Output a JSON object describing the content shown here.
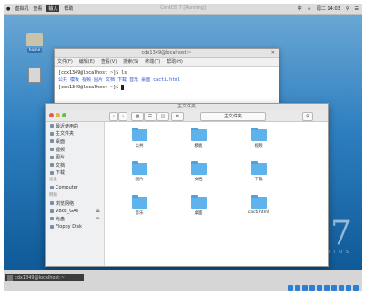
{
  "host": {
    "menubar": [
      "虚拟机",
      "查看",
      "输入",
      "帮助"
    ],
    "title": "CentOS 7 [Running]",
    "status_right": [
      "中",
      "周二 14:03"
    ]
  },
  "desktop": {
    "home_icon_label": "home",
    "brand_number": "7",
    "brand_text": "C E N T O S"
  },
  "terminal": {
    "title": "cdx1349@localhost:~",
    "menu": [
      "文件(F)",
      "编辑(E)",
      "查看(V)",
      "搜索(S)",
      "终端(T)",
      "帮助(H)"
    ],
    "lines": [
      "[cdx1349@localhost ~]$ ls",
      "[cdx1349@localhost ~]$ "
    ],
    "ls_output": "公共  模板  视频  图片  文档  下载  音乐  桌面  cacti.html"
  },
  "file_manager": {
    "title": "主文件夹",
    "sidebar": {
      "places": [
        "最近使用的",
        "主文件夹",
        "桌面",
        "视频",
        "图片",
        "文档",
        "下载",
        "音乐"
      ],
      "devices_header": "设备",
      "devices": [
        "Computer"
      ],
      "network_header": "网络",
      "network": [
        "浏览网络"
      ],
      "other": [
        "VBox_GAs",
        "光盘",
        "Floppy Disk"
      ]
    },
    "folders": [
      "公共",
      "模板",
      "视频",
      "图片",
      "文档",
      "下载",
      "音乐",
      "桌面",
      "cacti.html"
    ]
  },
  "taskbar": {
    "task_label": "cdx1349@localhost:~"
  },
  "colors": {
    "folder": "#5fb3ec",
    "desktop_top": "#6aa7d4",
    "desktop_bottom": "#0f5a98"
  }
}
